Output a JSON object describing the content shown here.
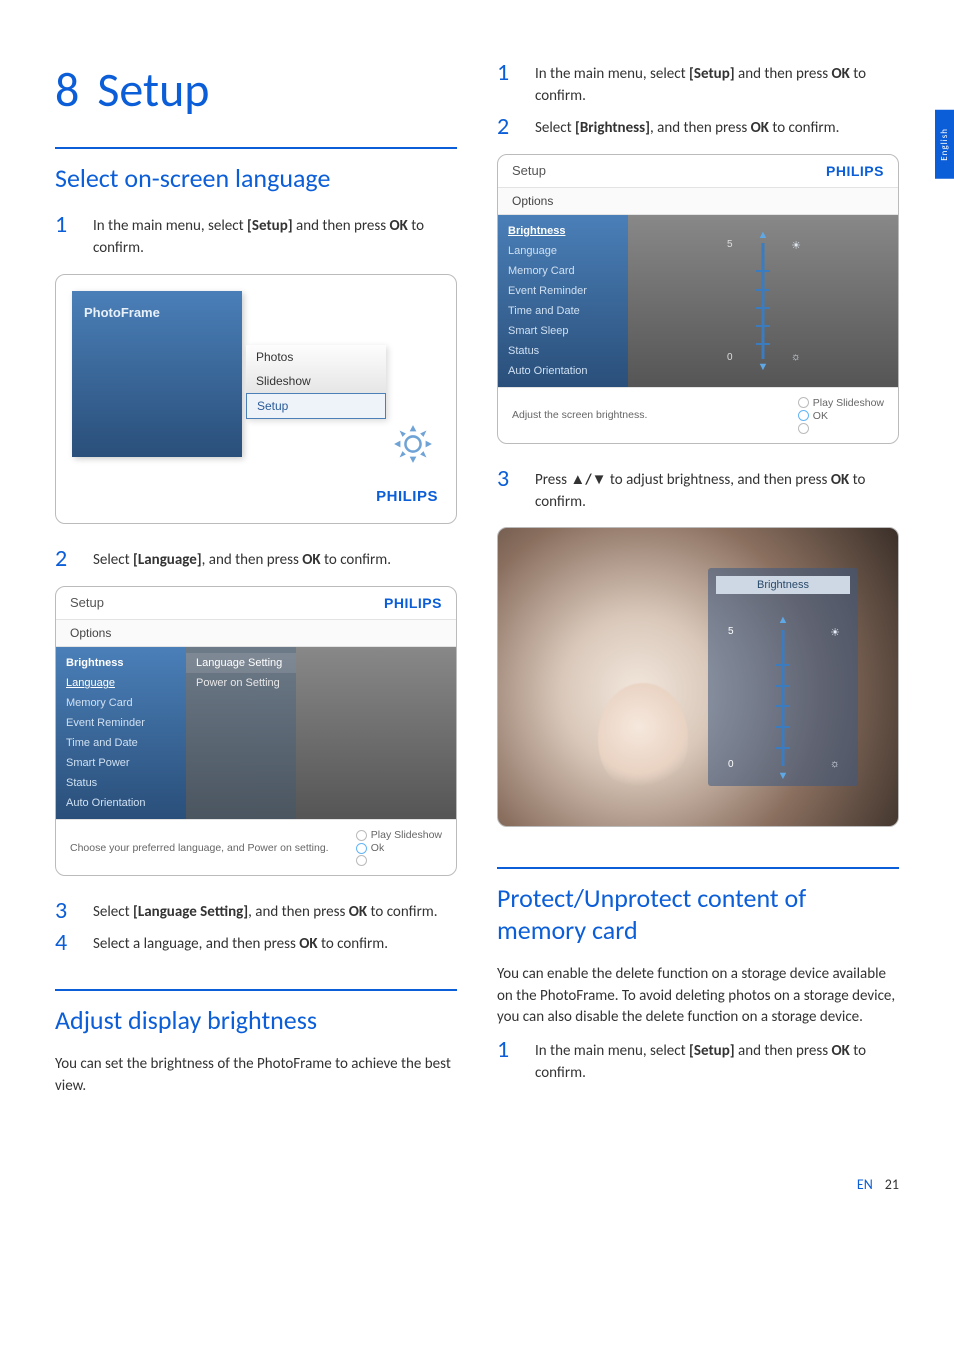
{
  "sideTab": "English",
  "chapter": {
    "num": "8",
    "title": "Setup"
  },
  "sections": {
    "lang": {
      "title": "Select on-screen language",
      "steps": [
        {
          "n": "1",
          "pre": "In the main menu, select ",
          "bold1": "[Setup]",
          "mid": " and then press ",
          "bold2": "OK",
          "post": " to confirm."
        },
        {
          "n": "2",
          "pre": "Select ",
          "bold1": "[Language]",
          "mid": ", and then press ",
          "bold2": "OK",
          "post": " to confirm."
        },
        {
          "n": "3",
          "pre": "Select ",
          "bold1": "[Language Setting]",
          "mid": ", and then press ",
          "bold2": "OK",
          "post": " to confirm."
        },
        {
          "n": "4",
          "pre": "Select a language, and then press ",
          "bold1": "OK",
          "mid": "",
          "bold2": "",
          "post": " to confirm."
        }
      ]
    },
    "bright": {
      "title": "Adjust display brightness",
      "intro": "You can set the brightness of the PhotoFrame to achieve the best view.",
      "steps": [
        {
          "n": "1",
          "pre": "In the main menu, select ",
          "bold1": "[Setup]",
          "mid": " and then press ",
          "bold2": "OK",
          "post": " to confirm."
        },
        {
          "n": "2",
          "pre": "Select ",
          "bold1": "[Brightness]",
          "mid": ", and then press ",
          "bold2": "OK",
          "post": " to confirm."
        },
        {
          "n": "3",
          "pre": "Press ",
          "bold1": "▲/▼",
          "mid": " to adjust brightness, and then press ",
          "bold2": "OK",
          "post": " to confirm."
        }
      ]
    },
    "protect": {
      "title": "Protect/Unprotect content of memory card",
      "intro": "You can enable the delete function on a storage device available on the PhotoFrame. To avoid deleting photos on a storage device, you can also disable the delete function on a storage device.",
      "steps": [
        {
          "n": "1",
          "pre": "In the main menu, select ",
          "bold1": "[Setup]",
          "mid": " and then press ",
          "bold2": "OK",
          "post": " to confirm."
        }
      ]
    }
  },
  "fig1": {
    "title": "PhotoFrame",
    "items": [
      "Photos",
      "Slideshow",
      "Setup"
    ],
    "brand": "PHILIPS"
  },
  "fig2": {
    "header": "Setup",
    "brand": "PHILIPS",
    "sub": "Options",
    "left": [
      "Brightness",
      "Language",
      "Memory Card",
      "Event Reminder",
      "Time and Date",
      "Smart Power",
      "Status",
      "Auto Orientation"
    ],
    "mid": [
      "Language Setting",
      "Power on Setting"
    ],
    "foot": "Choose your preferred language, and Power on setting.",
    "hint1": "Play Slideshow",
    "hint2": "Ok"
  },
  "fig3": {
    "header": "Setup",
    "brand": "PHILIPS",
    "sub": "Options",
    "left": [
      "Brightness",
      "Language",
      "Memory Card",
      "Event Reminder",
      "Time and Date",
      "Smart Sleep",
      "Status",
      "Auto Orientation"
    ],
    "sliderTop": "5",
    "sliderBot": "0",
    "foot": "Adjust the screen brightness.",
    "hint1": "Play Slideshow",
    "hint2": "OK"
  },
  "fig4": {
    "title": "Brightness",
    "sliderTop": "5",
    "sliderBot": "0"
  },
  "footer": {
    "lang": "EN",
    "page": "21"
  }
}
